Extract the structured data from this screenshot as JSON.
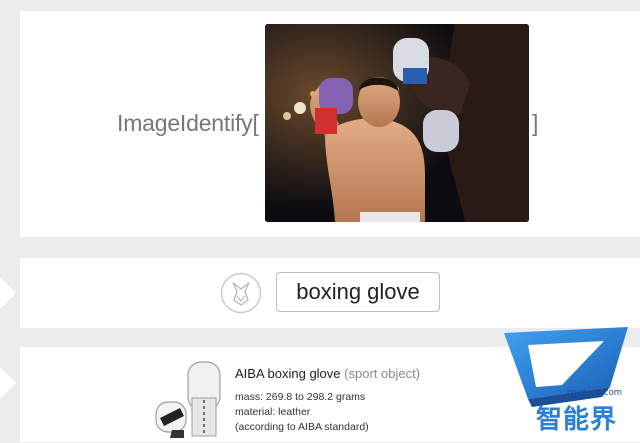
{
  "input": {
    "function_name": "ImageIdentify[",
    "closing_bracket": "]"
  },
  "output": {
    "result": "boxing glove"
  },
  "result_detail": {
    "entity_name": "AIBA boxing glove",
    "entity_category": "(sport object)",
    "mass": "mass: 269.8 to 298.2 grams",
    "material": "material: leather",
    "standard": "(according to AIBA standard)"
  },
  "watermark": {
    "site": "znjchina.com",
    "chinese": "智能界"
  },
  "icons": {
    "wolfram_logo": "wolf-icon",
    "glove_thumbnail": "boxing-glove-icon"
  },
  "colors": {
    "background": "#ececec",
    "card": "#ffffff",
    "watermark_blue": "#2b7fd6"
  }
}
